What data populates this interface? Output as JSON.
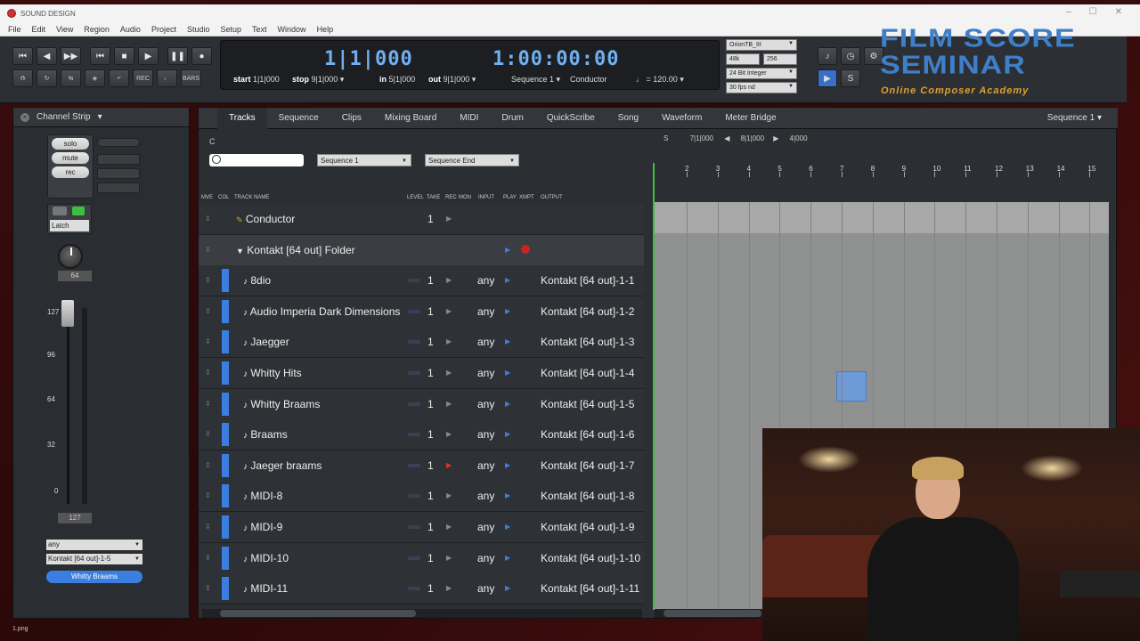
{
  "window": {
    "title": "SOUND DESIGN",
    "controls": [
      "–",
      "☐",
      "✕"
    ]
  },
  "menu": [
    "File",
    "Edit",
    "View",
    "Region",
    "Audio",
    "Project",
    "Studio",
    "Setup",
    "Text",
    "Window",
    "Help"
  ],
  "transport": {
    "position": "1|1|000",
    "time": "1:00:00:00",
    "start_label": "start",
    "start": "1|1|000",
    "stop_label": "stop",
    "stop": "9|1|000",
    "in_label": "in",
    "in": "5|1|000",
    "out_label": "out",
    "out": "9|1|000",
    "sequence": "Sequence 1",
    "conductor": "Conductor",
    "tempo": "= 120.00",
    "rec_label": "REC",
    "bars_label": "BARS"
  },
  "audio_settings": {
    "device": "OrionTB_III",
    "sample_rate": "48k",
    "buffer": "256",
    "bit_depth": "24 Bit Integer",
    "frame_rate": "30 fps nd"
  },
  "logo": {
    "line1": "FILM SCORE",
    "line2": "SEMINAR",
    "tagline": "Online Composer Academy"
  },
  "channel_strip": {
    "title": "Channel Strip",
    "solo": "solo",
    "mute": "mute",
    "rec": "rec",
    "automation_mode": "Latch",
    "pan_value": "64",
    "fader_scale": [
      "127",
      "96",
      "64",
      "32",
      "0"
    ],
    "fader_value": "127",
    "input": "any",
    "output": "Kontakt [64 out]-1-5",
    "track_name": "Whitty Braams"
  },
  "tabs": [
    "Tracks",
    "Sequence",
    "Clips",
    "Mixing Board",
    "MIDI",
    "Drum",
    "QuickScribe",
    "Song",
    "Waveform",
    "Meter Bridge"
  ],
  "active_tab": "Tracks",
  "sequence_menu": "Sequence 1",
  "filter": {
    "c_label": "C",
    "sequence_select": "Sequence 1",
    "end_select": "Sequence End"
  },
  "columns": [
    "MVE",
    "COL",
    "TRACK NAME",
    "LEVEL",
    "TAKE",
    "REC",
    "MON",
    "INPUT",
    "PLAY",
    "XMPT",
    "OUTPUT"
  ],
  "tracks": [
    {
      "name": "Conductor",
      "type": "conductor",
      "take": "1",
      "input": "",
      "output": ""
    },
    {
      "name": "Kontakt [64 out] Folder",
      "type": "folder",
      "take": "",
      "input": "",
      "output": ""
    },
    {
      "name": "8dio",
      "type": "midi",
      "take": "1",
      "input": "any",
      "output": "Kontakt [64 out]-1-1"
    },
    {
      "name": "Audio Imperia Dark Dimensions",
      "type": "midi",
      "take": "1",
      "input": "any",
      "output": "Kontakt [64 out]-1-2"
    },
    {
      "name": "Jaegger",
      "type": "midi",
      "take": "1",
      "input": "any",
      "output": "Kontakt [64 out]-1-3"
    },
    {
      "name": "Whitty Hits",
      "type": "midi",
      "take": "1",
      "input": "any",
      "output": "Kontakt [64 out]-1-4"
    },
    {
      "name": "Whitty Braams",
      "type": "midi",
      "take": "1",
      "input": "any",
      "output": "Kontakt [64 out]-1-5"
    },
    {
      "name": "Braams",
      "type": "midi",
      "take": "1",
      "input": "any",
      "output": "Kontakt [64 out]-1-6"
    },
    {
      "name": "Jaeger braams",
      "type": "midi",
      "take": "1",
      "input": "any",
      "output": "Kontakt [64 out]-1-7"
    },
    {
      "name": "MIDI-8",
      "type": "midi",
      "take": "1",
      "input": "any",
      "output": "Kontakt [64 out]-1-8"
    },
    {
      "name": "MIDI-9",
      "type": "midi",
      "take": "1",
      "input": "any",
      "output": "Kontakt [64 out]-1-9"
    },
    {
      "name": "MIDI-10",
      "type": "midi",
      "take": "1",
      "input": "any",
      "output": "Kontakt [64 out]-1-10"
    },
    {
      "name": "MIDI-11",
      "type": "midi",
      "take": "1",
      "input": "any",
      "output": "Kontakt [64 out]-1-11"
    }
  ],
  "timeline": {
    "s_label": "S",
    "from": "7|1|000",
    "to": "8|1|000",
    "length": "4|000",
    "bars": [
      "2",
      "3",
      "4",
      "5",
      "6",
      "7",
      "8",
      "9",
      "10",
      "11",
      "12",
      "13",
      "14",
      "15"
    ]
  },
  "footer": "1.png"
}
